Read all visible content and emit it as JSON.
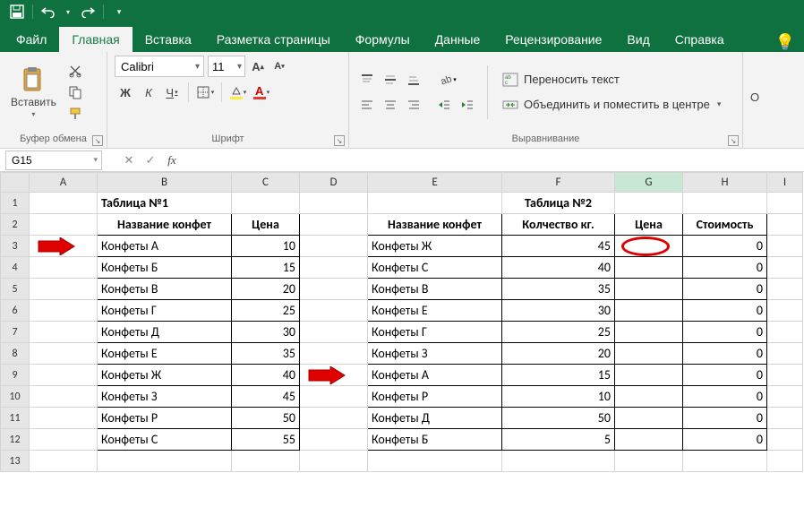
{
  "titlebar": {
    "save_icon": "save",
    "undo_icon": "undo",
    "redo_icon": "redo"
  },
  "tabs": {
    "file": "Файл",
    "home": "Главная",
    "insert": "Вставка",
    "layout": "Разметка страницы",
    "formulas": "Формулы",
    "data": "Данные",
    "review": "Рецензирование",
    "view": "Вид",
    "help": "Справка"
  },
  "ribbon": {
    "clipboard": {
      "paste": "Вставить",
      "group": "Буфер обмена"
    },
    "font": {
      "name": "Calibri",
      "size": "11",
      "bold": "Ж",
      "italic": "К",
      "underline": "Ч",
      "group": "Шрифт"
    },
    "alignment": {
      "wrap": "Переносить текст",
      "merge": "Объединить и поместить в центре",
      "group": "Выравнивание"
    },
    "number": {
      "btn": "О"
    }
  },
  "formula_bar": {
    "namebox": "G15",
    "fx": "fx",
    "value": ""
  },
  "columns": [
    "A",
    "B",
    "C",
    "D",
    "E",
    "F",
    "G",
    "H",
    "I"
  ],
  "active_column": "G",
  "rows": [
    1,
    2,
    3,
    4,
    5,
    6,
    7,
    8,
    9,
    10,
    11,
    12,
    13
  ],
  "table1": {
    "title": "Таблица №1",
    "h1": "Название конфет",
    "h2": "Цена",
    "rows": [
      {
        "name": "Конфеты А",
        "price": 10
      },
      {
        "name": "Конфеты Б",
        "price": 15
      },
      {
        "name": "Конфеты В",
        "price": 20
      },
      {
        "name": "Конфеты Г",
        "price": 25
      },
      {
        "name": "Конфеты Д",
        "price": 30
      },
      {
        "name": "Конфеты Е",
        "price": 35
      },
      {
        "name": "Конфеты Ж",
        "price": 40
      },
      {
        "name": "Конфеты З",
        "price": 45
      },
      {
        "name": "Конфеты Р",
        "price": 50
      },
      {
        "name": "Конфеты С",
        "price": 55
      }
    ]
  },
  "table2": {
    "title": "Таблица №2",
    "h1": "Название конфет",
    "h2": "Колчество кг.",
    "h3": "Цена",
    "h4": "Стоимость",
    "rows": [
      {
        "name": "Конфеты Ж",
        "qty": 45,
        "price": "",
        "cost": 0
      },
      {
        "name": "Конфеты С",
        "qty": 40,
        "price": "",
        "cost": 0
      },
      {
        "name": "Конфеты В",
        "qty": 35,
        "price": "",
        "cost": 0
      },
      {
        "name": "Конфеты Е",
        "qty": 30,
        "price": "",
        "cost": 0
      },
      {
        "name": "Конфеты Г",
        "qty": 25,
        "price": "",
        "cost": 0
      },
      {
        "name": "Конфеты З",
        "qty": 20,
        "price": "",
        "cost": 0
      },
      {
        "name": "Конфеты А",
        "qty": 15,
        "price": "",
        "cost": 0
      },
      {
        "name": "Конфеты Р",
        "qty": 10,
        "price": "",
        "cost": 0
      },
      {
        "name": "Конфеты Д",
        "qty": 50,
        "price": "",
        "cost": 0
      },
      {
        "name": "Конфеты Б",
        "qty": 5,
        "price": "",
        "cost": 0
      }
    ]
  }
}
